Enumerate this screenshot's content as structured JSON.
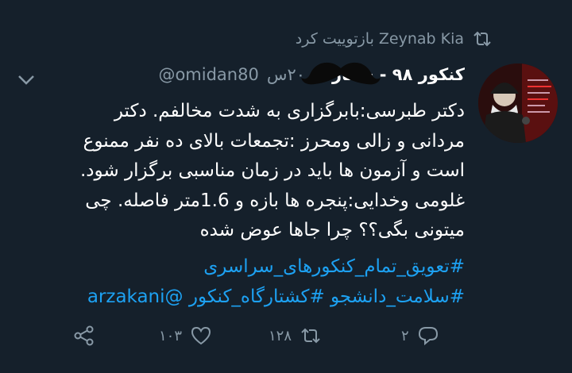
{
  "retweet": {
    "user": "Zeynab Kia",
    "label": "بازتوییت کرد"
  },
  "tweet": {
    "display_name": "کنکور ۹۸ - شعار...",
    "handle": "@omidan80",
    "time": "۲۰س",
    "lines": [
      "دکتر طبرسی:بابرگزاری به شدت مخالفم. دکتر",
      "مردانی و زالی ومحرز :تجمعات بالای ده نفر ممنوع",
      "است و آزمون ها باید در زمان مناسبی برگزار شود.",
      "غلومی وخدایی:پنجره ها بازه و 1.6متر فاصله. چی",
      "میتونی بگی؟؟ چرا جاها عوض شده"
    ],
    "hashtag1": "#تعویق_تمام_کنکورهای_سراسری",
    "hashtag2": "#سلامت_دانشجو #کشتارگاه_کنکور",
    "mention": "@arzakani"
  },
  "actions": {
    "reply_count": "۲",
    "retweet_count": "۱۲۸",
    "like_count": "۱۰۳"
  },
  "colors": {
    "background": "#15202b",
    "secondary_text": "#8899a6",
    "link": "#1da1f2"
  }
}
